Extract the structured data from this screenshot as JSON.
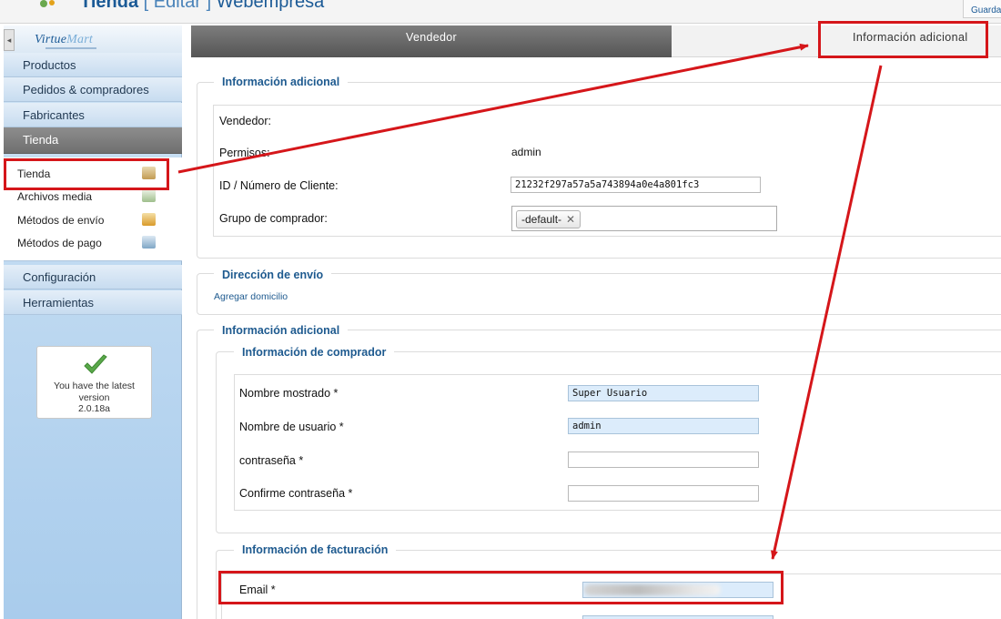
{
  "header": {
    "title_main": "Tienda",
    "title_edit": "[ Editar ]",
    "title_site": "Webempresa",
    "save_label": "Guardar"
  },
  "sidebar": {
    "logo_text_a": "Virtue",
    "logo_text_b": "Mart",
    "items": [
      {
        "label": "Productos"
      },
      {
        "label": "Pedidos & compradores"
      },
      {
        "label": "Fabricantes"
      },
      {
        "label": "Tienda"
      },
      {
        "label": "Configuración"
      },
      {
        "label": "Herramientas"
      }
    ],
    "active_item": "Tienda",
    "subitems": [
      {
        "label": "Tienda",
        "icon": "store-icon"
      },
      {
        "label": "Archivos media",
        "icon": "media-icon"
      },
      {
        "label": "Métodos de envío",
        "icon": "truck-icon"
      },
      {
        "label": "Métodos de pago",
        "icon": "payment-icon"
      }
    ],
    "version": {
      "line1": "You have the latest",
      "line2": "version",
      "line3": "2.0.18a"
    }
  },
  "tabs": {
    "vendor": "Vendedor",
    "additional": "Información adicional"
  },
  "section1": {
    "legend": "Información adicional",
    "rows": [
      {
        "label": "Vendedor:",
        "value": ""
      },
      {
        "label": "Permisos:",
        "value": "admin"
      },
      {
        "label": "ID / Número de Cliente:",
        "value": "21232f297a57a5a743894a0e4a801fc3"
      },
      {
        "label": "Grupo de comprador:",
        "value": "-default-"
      }
    ]
  },
  "section2": {
    "legend": "Dirección de envío",
    "link": "Agregar domicilio"
  },
  "section3": {
    "legend": "Información adicional",
    "buyer": {
      "legend": "Información de comprador",
      "rows": [
        {
          "label": "Nombre mostrado *",
          "value": "Super Usuario"
        },
        {
          "label": "Nombre de usuario *",
          "value": "admin"
        },
        {
          "label": "contraseña *",
          "value": ""
        },
        {
          "label": "Confirme contraseña *",
          "value": ""
        }
      ]
    },
    "billing": {
      "legend": "Información de facturación",
      "rows": [
        {
          "label": "Email *",
          "value": ""
        }
      ]
    }
  },
  "colors": {
    "accent": "#1e5a8f",
    "annotation": "#d5161a",
    "sidebar_active": "#7a7a7a",
    "filled_input": "#dcecfb"
  }
}
